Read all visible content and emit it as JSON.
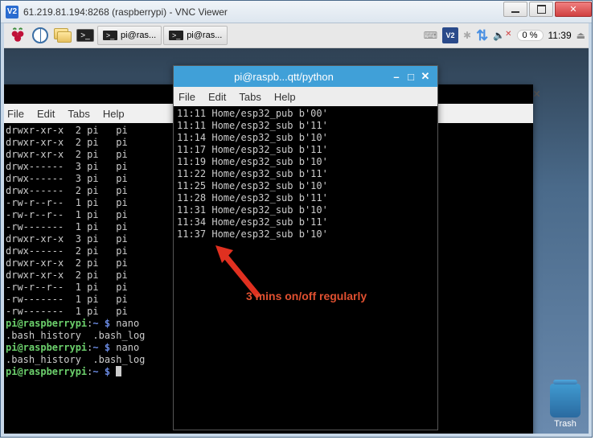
{
  "window": {
    "icon_text": "V2",
    "title": "61.219.81.194:8268 (raspberrypi) - VNC Viewer",
    "close_glyph": "✕"
  },
  "panel": {
    "tasks": [
      {
        "label": "pi@ras..."
      },
      {
        "label": "pi@ras..."
      }
    ],
    "vnc_label": "V2",
    "bluetooth_glyph": "✱",
    "net_glyph": "⇅",
    "sound_glyph": "🔈",
    "sound_mute_glyph": "✕",
    "percent": "0 %",
    "time": "11:39",
    "eject_glyph": "⏏"
  },
  "back_term": {
    "menu": {
      "file": "File",
      "edit": "Edit",
      "tabs": "Tabs",
      "help": "Help"
    },
    "btns": {
      "min": "–",
      "max": "□",
      "close": "✕"
    },
    "listing": [
      "drwxr-xr-x  2 pi   pi",
      "drwxr-xr-x  2 pi   pi",
      "drwxr-xr-x  2 pi   pi",
      "drwx------  3 pi   pi",
      "drwx------  3 pi   pi",
      "drwx------  2 pi   pi",
      "-rw-r--r--  1 pi   pi",
      "-rw-r--r--  1 pi   pi",
      "-rw-------  1 pi   pi",
      "drwxr-xr-x  3 pi   pi",
      "drwx------  2 pi   pi",
      "drwxr-xr-x  2 pi   pi",
      "drwxr-xr-x  2 pi   pi",
      "-rw-r--r--  1 pi   pi",
      "-rw-------  1 pi   pi",
      "-rw-------  1 pi   pi"
    ],
    "prompt_user": "pi@raspberrypi",
    "prompt_sep": ":",
    "prompt_path": "~ $",
    "cmd": "nano",
    "files_line": ".bash_history  .bash_log"
  },
  "front_term": {
    "title": "pi@raspb...qtt/python",
    "btns": {
      "min": "–",
      "max": "□",
      "close": "✕"
    },
    "menu": {
      "file": "File",
      "edit": "Edit",
      "tabs": "Tabs",
      "help": "Help"
    },
    "lines": [
      "11:11 Home/esp32_pub b'00'",
      "11:11 Home/esp32_sub b'11'",
      "11:14 Home/esp32_sub b'10'",
      "11:17 Home/esp32_sub b'11'",
      "11:19 Home/esp32_sub b'10'",
      "11:22 Home/esp32_sub b'11'",
      "11:25 Home/esp32_sub b'10'",
      "11:28 Home/esp32_sub b'11'",
      "11:31 Home/esp32_sub b'10'",
      "11:34 Home/esp32_sub b'11'",
      "11:37 Home/esp32_sub b'10'"
    ]
  },
  "annotation": {
    "text": "3 mins on/off regularly"
  },
  "trash": {
    "label": "Trash"
  }
}
